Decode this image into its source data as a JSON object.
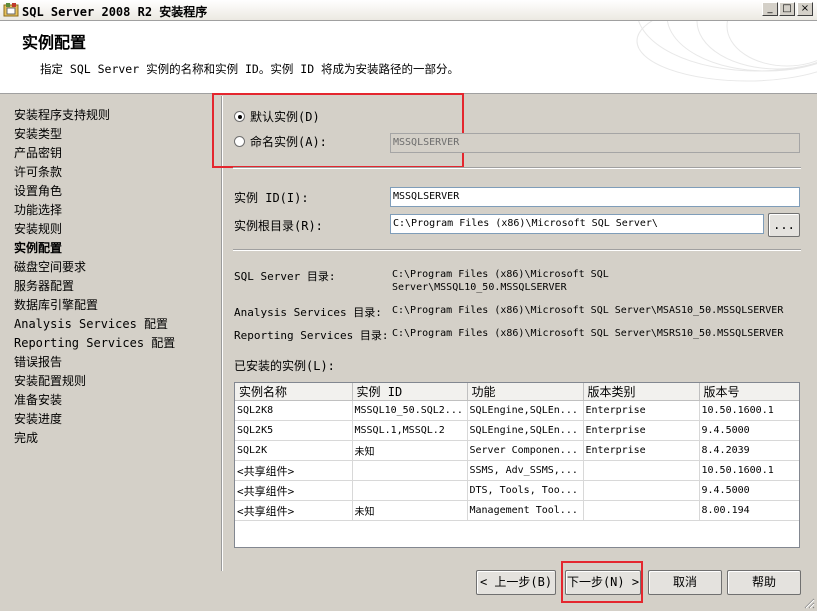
{
  "window": {
    "title": "SQL Server 2008 R2 安装程序",
    "controls": {
      "minimize": "_",
      "maximize": "□",
      "close": "×"
    }
  },
  "header": {
    "title": "实例配置",
    "subtitle": "指定 SQL Server 实例的名称和实例 ID。实例 ID 将成为安装路径的一部分。"
  },
  "nav": {
    "items": [
      {
        "label": "安装程序支持规则",
        "active": false
      },
      {
        "label": "安装类型",
        "active": false
      },
      {
        "label": "产品密钥",
        "active": false
      },
      {
        "label": "许可条款",
        "active": false
      },
      {
        "label": "设置角色",
        "active": false
      },
      {
        "label": "功能选择",
        "active": false
      },
      {
        "label": "安装规则",
        "active": false
      },
      {
        "label": "实例配置",
        "active": true
      },
      {
        "label": "磁盘空间要求",
        "active": false
      },
      {
        "label": "服务器配置",
        "active": false
      },
      {
        "label": "数据库引擎配置",
        "active": false
      },
      {
        "label": "Analysis Services 配置",
        "active": false
      },
      {
        "label": "Reporting Services 配置",
        "active": false
      },
      {
        "label": "错误报告",
        "active": false
      },
      {
        "label": "安装配置规则",
        "active": false
      },
      {
        "label": "准备安装",
        "active": false
      },
      {
        "label": "安装进度",
        "active": false
      },
      {
        "label": "完成",
        "active": false
      }
    ]
  },
  "instance": {
    "default_label": "默认实例(D)",
    "named_label": "命名实例(A):",
    "named_value": "MSSQLSERVER",
    "selected": "default",
    "id_label": "实例 ID(I):",
    "id_value": "MSSQLSERVER",
    "root_label": "实例根目录(R):",
    "root_value": "C:\\Program Files (x86)\\Microsoft SQL Server\\",
    "browse_label": "..."
  },
  "dirs": {
    "sql_label": "SQL Server 目录:",
    "sql_value_line1": "C:\\Program Files (x86)\\Microsoft SQL",
    "sql_value_line2": "Server\\MSSQL10_50.MSSQLSERVER",
    "as_label": "Analysis Services 目录:",
    "as_value": "C:\\Program Files (x86)\\Microsoft SQL Server\\MSAS10_50.MSSQLSERVER",
    "rs_label": "Reporting Services 目录:",
    "rs_value": "C:\\Program Files (x86)\\Microsoft SQL Server\\MSRS10_50.MSSQLSERVER"
  },
  "installed": {
    "label": "已安装的实例(L):",
    "columns": [
      "实例名称",
      "实例 ID",
      "功能",
      "版本类别",
      "版本号"
    ],
    "rows": [
      [
        "SQL2K8",
        "MSSQL10_50.SQL2...",
        "SQLEngine,SQLEn...",
        "Enterprise",
        "10.50.1600.1"
      ],
      [
        "SQL2K5",
        "MSSQL.1,MSSQL.2",
        "SQLEngine,SQLEn...",
        "Enterprise",
        "9.4.5000"
      ],
      [
        "SQL2K",
        "未知",
        "Server Componen...",
        "Enterprise",
        "8.4.2039"
      ],
      [
        "<共享组件>",
        "",
        "SSMS, Adv_SSMS,...",
        "",
        "10.50.1600.1"
      ],
      [
        "<共享组件>",
        "",
        "DTS, Tools, Too...",
        "",
        "9.4.5000"
      ],
      [
        "<共享组件>",
        "未知",
        "Management Tool...",
        "",
        "8.00.194"
      ]
    ]
  },
  "buttons": {
    "back": "< 上一步(B)",
    "next": "下一步(N) >",
    "cancel": "取消",
    "help": "帮助"
  }
}
